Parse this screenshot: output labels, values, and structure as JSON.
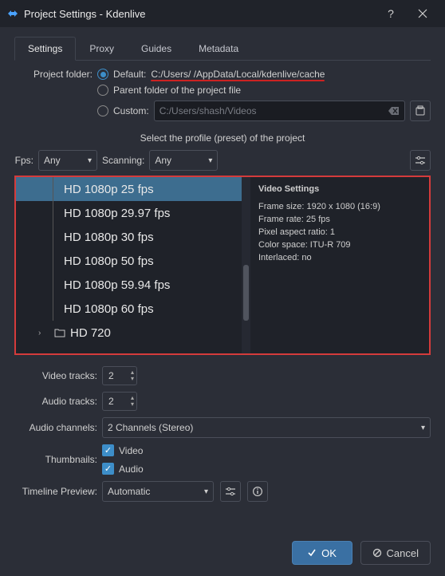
{
  "titlebar": {
    "title": "Project Settings - Kdenlive"
  },
  "tabs": {
    "settings": "Settings",
    "proxy": "Proxy",
    "guides": "Guides",
    "metadata": "Metadata"
  },
  "project_folder": {
    "label": "Project folder:",
    "default_label": "Default:",
    "default_path": "C:/Users/         /AppData/Local/kdenlive/cache",
    "parent_label": "Parent folder of the project file",
    "custom_label": "Custom:",
    "custom_placeholder": "C:/Users/shash/Videos"
  },
  "profile": {
    "heading": "Select the profile (preset) of the project",
    "fps_label": "Fps:",
    "fps_value": "Any",
    "scanning_label": "Scanning:",
    "scanning_value": "Any"
  },
  "profiles": {
    "items": [
      "HD 1080p 25 fps",
      "HD 1080p 29.97 fps",
      "HD 1080p 30 fps",
      "HD 1080p 50 fps",
      "HD 1080p 59.94 fps",
      "HD 1080p 60 fps"
    ],
    "group_hd720": "HD 720"
  },
  "video_settings": {
    "heading": "Video Settings",
    "frame_size": "Frame size: 1920 x 1080 (16:9)",
    "frame_rate": "Frame rate: 25 fps",
    "pixel_aspect": "Pixel aspect ratio: 1",
    "color_space": "Color space: ITU-R 709",
    "interlaced": "Interlaced: no"
  },
  "tracks": {
    "video_label": "Video tracks:",
    "video_value": "2",
    "audio_label": "Audio tracks:",
    "audio_value": "2",
    "channels_label": "Audio channels:",
    "channels_value": "2 Channels (Stereo)",
    "thumb_label": "Thumbnails:",
    "thumb_video": "Video",
    "thumb_audio": "Audio",
    "timeline_label": "Timeline Preview:",
    "timeline_value": "Automatic"
  },
  "footer": {
    "ok": "OK",
    "cancel": "Cancel"
  }
}
